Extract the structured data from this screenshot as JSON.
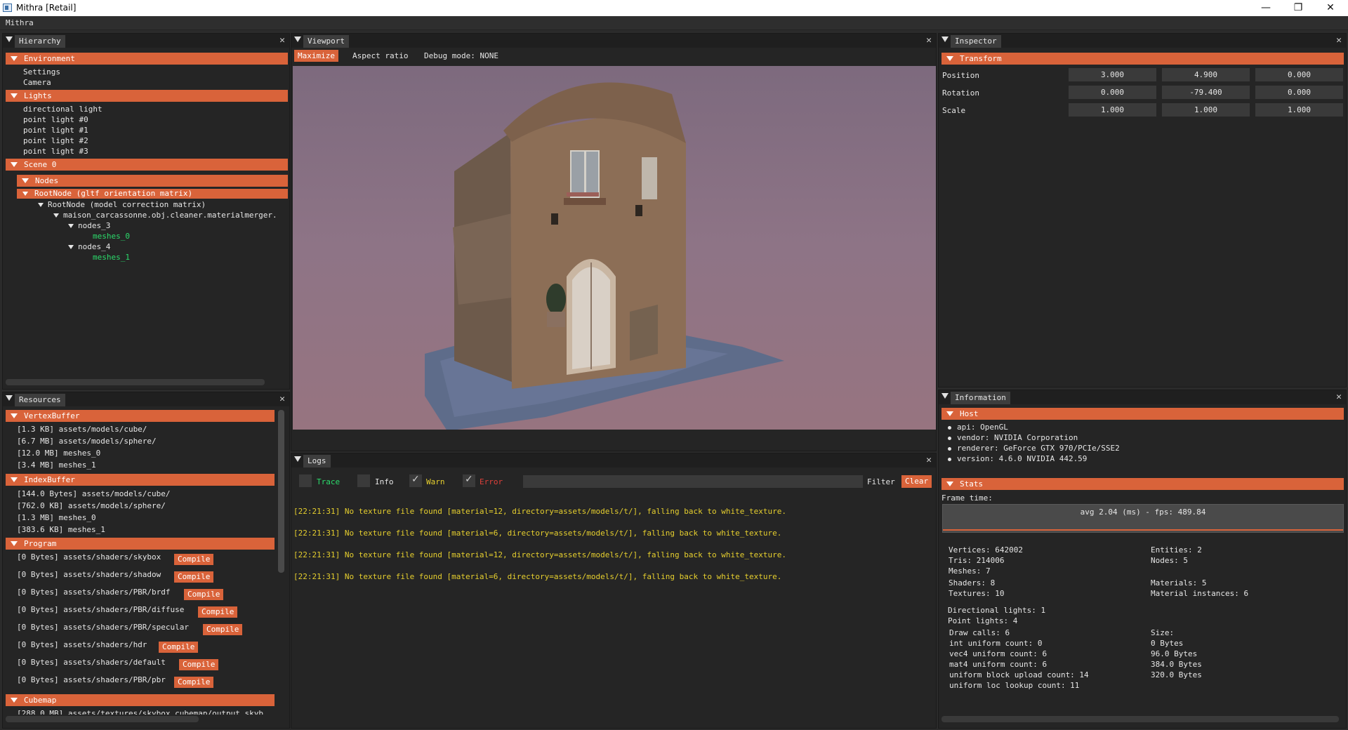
{
  "window": {
    "title": "Mithra [Retail]",
    "minimize": "—",
    "restore": "❐",
    "close": "✕"
  },
  "menubar": {
    "app_menu": "Mithra"
  },
  "hierarchy": {
    "tab": "Hierarchy",
    "sections": {
      "environment": "Environment",
      "lights": "Lights",
      "scene": "Scene 0",
      "nodes": "Nodes"
    },
    "environment_items": [
      "Settings",
      "Camera"
    ],
    "light_items": [
      "directional light",
      "point light #0",
      "point light #1",
      "point light #2",
      "point light #3"
    ],
    "root_node": "RootNode (gltf orientation matrix)",
    "tree": {
      "correction": "RootNode (model correction matrix)",
      "merger": "maison_carcassonne.obj.cleaner.materialmerger.",
      "nodes_3": "nodes_3",
      "meshes_0": "meshes_0",
      "nodes_4": "nodes_4",
      "meshes_1": "meshes_1"
    }
  },
  "resources": {
    "tab": "Resources",
    "sections": {
      "vertex": "VertexBuffer",
      "index": "IndexBuffer",
      "program": "Program",
      "cubemap": "Cubemap"
    },
    "vertex_items": [
      "[1.3 KB] assets/models/cube/",
      "[6.7 MB] assets/models/sphere/",
      "[12.0 MB] meshes_0",
      "[3.4 MB] meshes_1"
    ],
    "index_items": [
      "[144.0 Bytes] assets/models/cube/",
      "[762.0 KB] assets/models/sphere/",
      "[1.3 MB] meshes_0",
      "[383.6 KB] meshes_1"
    ],
    "program_items": [
      "[0 Bytes] assets/shaders/skybox",
      "[0 Bytes] assets/shaders/shadow",
      "[0 Bytes] assets/shaders/PBR/brdf",
      "[0 Bytes] assets/shaders/PBR/diffuse",
      "[0 Bytes] assets/shaders/PBR/specular",
      "[0 Bytes] assets/shaders/hdr",
      "[0 Bytes] assets/shaders/default",
      "[0 Bytes] assets/shaders/PBR/pbr"
    ],
    "compile_label": "Compile",
    "cubemap_partial": "[288.0 MB] assets/textures/skybox_cubemap/output_skyb"
  },
  "viewport": {
    "tab": "Viewport",
    "maximize": "Maximize",
    "aspect_ratio": "Aspect ratio",
    "debug_mode": "Debug mode: NONE"
  },
  "logs": {
    "tab": "Logs",
    "trace": "Trace",
    "info": "Info",
    "warn": "Warn",
    "error": "Error",
    "filter_label": "Filter",
    "filter_value": "",
    "clear": "Clear",
    "lines": [
      "[22:21:31] No texture file found [material=12, directory=assets/models/t/], falling back to white_texture.",
      "[22:21:31] No texture file found [material=6, directory=assets/models/t/], falling back to white_texture.",
      "[22:21:31] No texture file found [material=12, directory=assets/models/t/], falling back to white_texture.",
      "[22:21:31] No texture file found [material=6, directory=assets/models/t/], falling back to white_texture."
    ]
  },
  "inspector": {
    "tab": "Inspector",
    "section": "Transform",
    "position_label": "Position",
    "rotation_label": "Rotation",
    "scale_label": "Scale",
    "position": [
      "3.000",
      "4.900",
      "0.000"
    ],
    "rotation": [
      "0.000",
      "-79.400",
      "0.000"
    ],
    "scale": [
      "1.000",
      "1.000",
      "1.000"
    ]
  },
  "information": {
    "tab": "Information",
    "host_section": "Host",
    "host_items": [
      "api: OpenGL",
      "vendor: NVIDIA Corporation",
      "renderer: GeForce GTX 970/PCIe/SSE2",
      "version: 4.6.0 NVIDIA 442.59"
    ],
    "stats_section": "Stats",
    "frame_time_label": "Frame time:",
    "frame_summary": "avg 2.04 (ms) - fps: 489.84",
    "stats_left": [
      "Vertices: 642002",
      "Tris: 214006",
      "Meshes: 7"
    ],
    "stats_right": [
      "Entities: 2",
      "Nodes: 5"
    ],
    "stats_left2": [
      "Shaders: 8",
      "Textures: 10"
    ],
    "stats_right2": [
      "Materials: 5",
      "Material instances: 6"
    ],
    "lights": [
      "Directional lights: 1",
      "Point lights: 4"
    ],
    "draw_left": [
      "Draw calls: 6",
      "int uniform count: 0",
      "vec4 uniform count: 6",
      "mat4 uniform count: 6",
      "uniform block upload count: 14",
      "uniform loc lookup count: 11"
    ],
    "draw_right": [
      "Size:",
      "0 Bytes",
      "96.0 Bytes",
      "384.0 Bytes",
      "320.0 Bytes"
    ]
  },
  "colors": {
    "accent": "#d9633a",
    "warn_text": "#e6cf2e",
    "trace_text": "#2bdb6b",
    "error_text": "#e0403a",
    "background": "#252525"
  }
}
